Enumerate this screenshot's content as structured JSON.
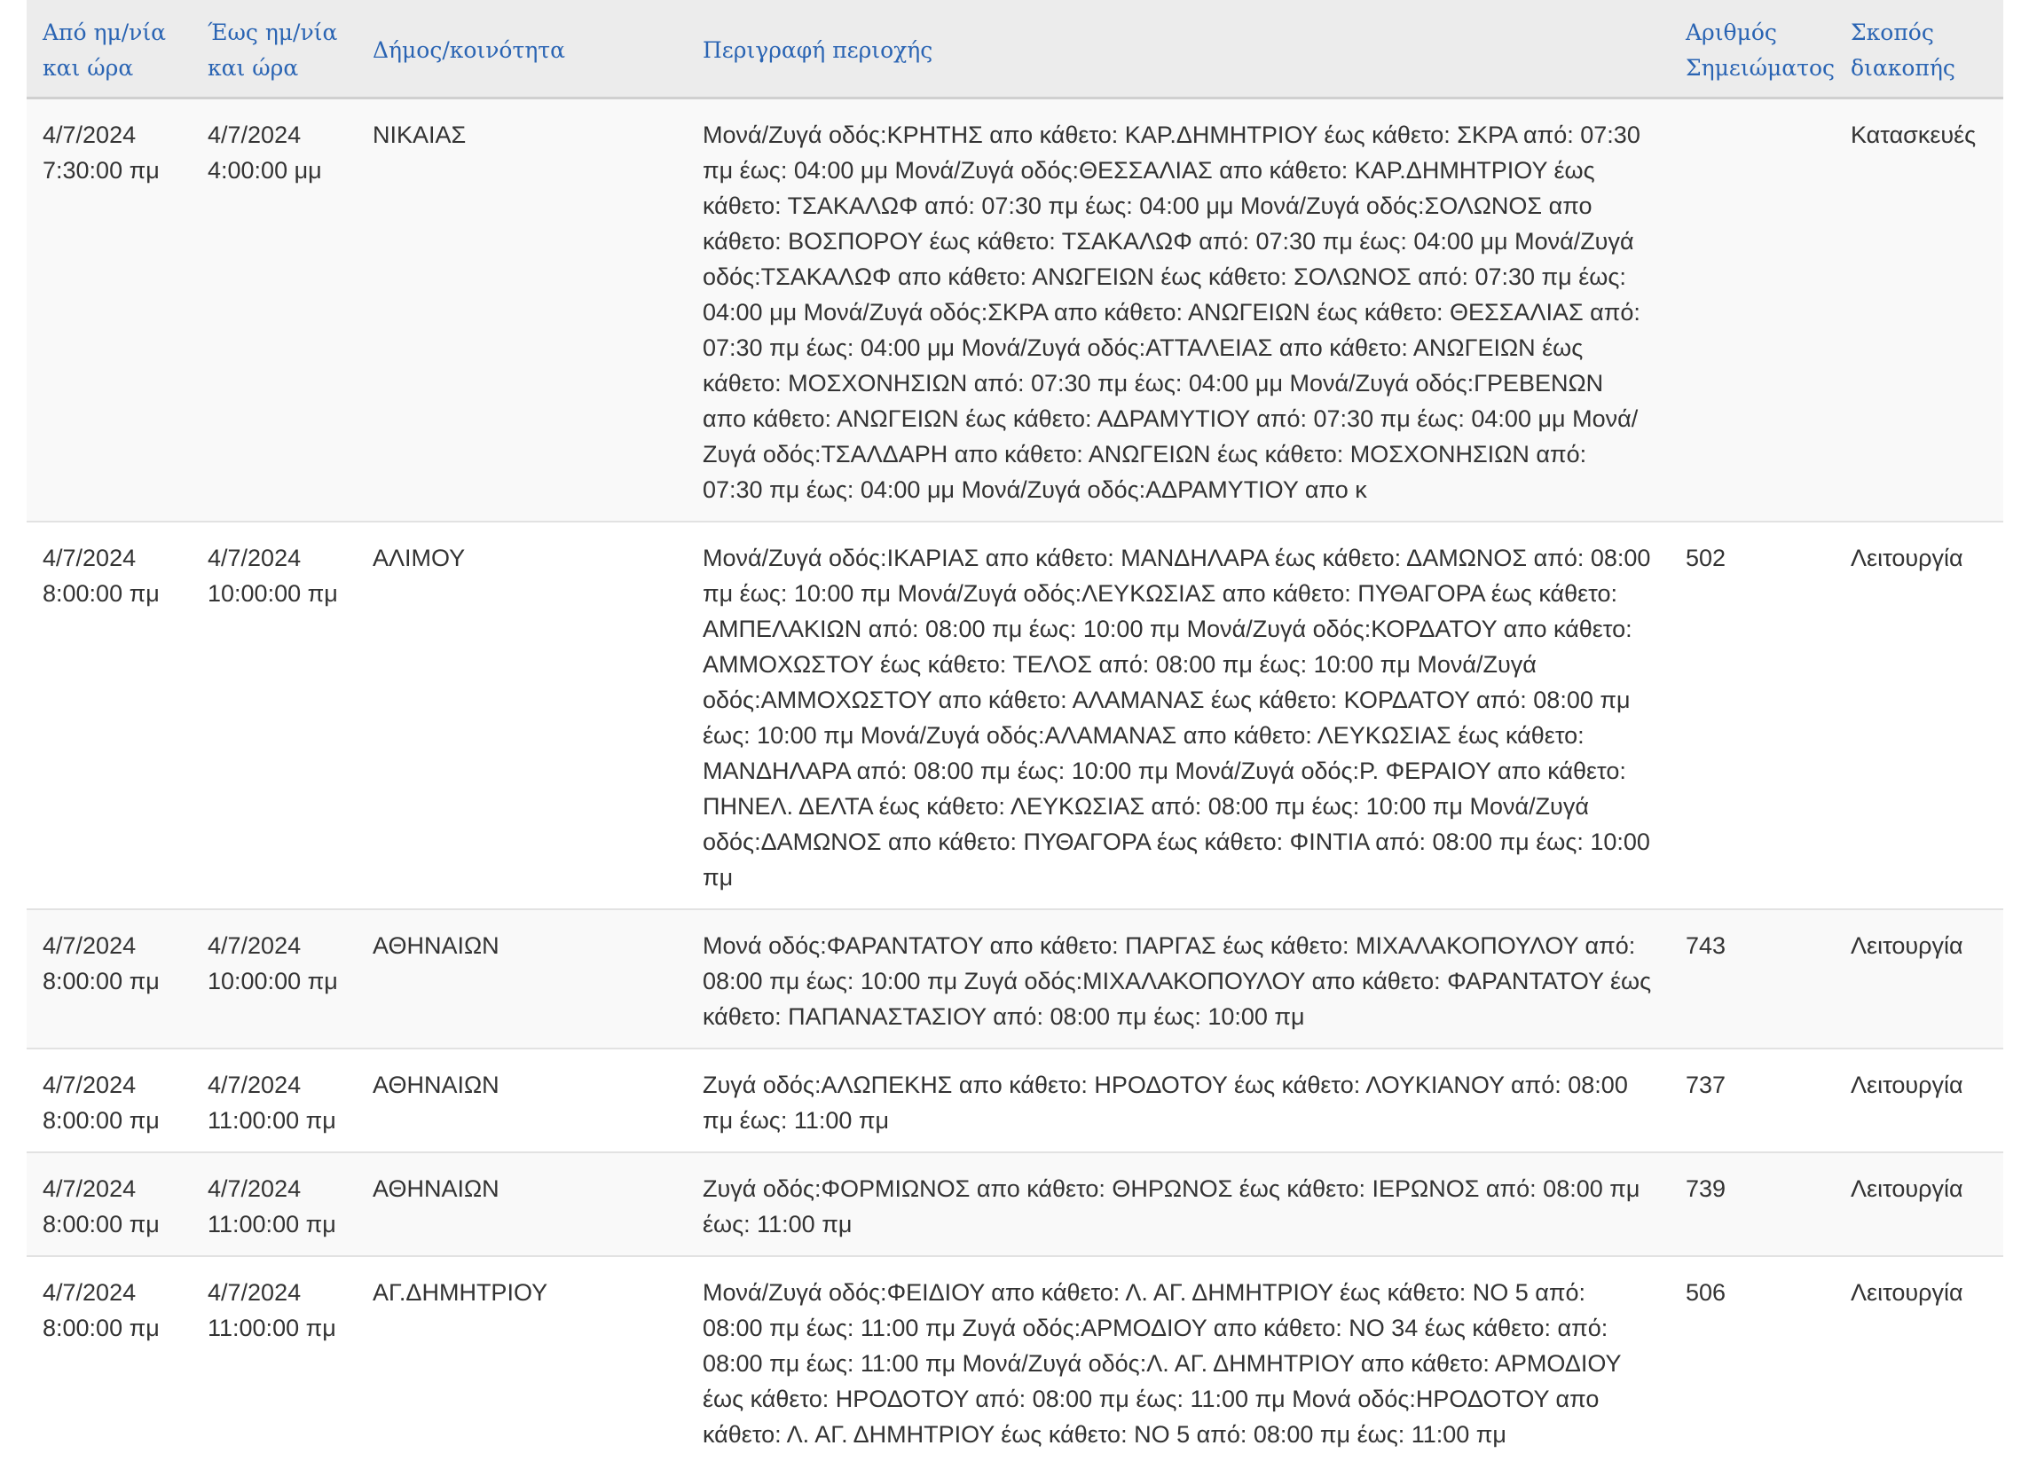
{
  "header": {
    "from": "Από ημ/νία και ώρα",
    "to": "Έως ημ/νία και ώρα",
    "municipality": "Δήμος/κοινότητα",
    "description": "Περιγραφή περιοχής",
    "note_number": "Αριθμός Σημειώματος",
    "purpose": "Σκοπός διακοπής"
  },
  "rows": [
    {
      "from": "4/7/2024 7:30:00 πμ",
      "to": "4/7/2024 4:00:00 μμ",
      "municipality": "ΝΙΚΑΙΑΣ",
      "description": "Μονά/Ζυγά οδός:ΚΡΗΤΗΣ απο κάθετο: ΚΑΡ.ΔΗΜΗΤΡΙΟΥ έως κάθετο: ΣΚΡΑ από: 07:30 πμ έως: 04:00 μμ Μονά/Ζυγά οδός:ΘΕΣΣΑΛΙΑΣ απο κάθετο: ΚΑΡ.ΔΗΜΗΤΡΙΟΥ έως κάθετο: ΤΣΑΚΑΛΩΦ από: 07:30 πμ έως: 04:00 μμ Μονά/Ζυγά οδός:ΣΟΛΩΝΟΣ απο κάθετο: ΒΟΣΠΟΡΟΥ έως κάθετο: ΤΣΑΚΑΛΩΦ από: 07:30 πμ έως: 04:00 μμ Μονά/Ζυγά οδός:ΤΣΑΚΑΛΩΦ απο κάθετο: ΑΝΩΓΕΙΩΝ έως κάθετο: ΣΟΛΩΝΟΣ από: 07:30 πμ έως: 04:00 μμ Μονά/Ζυγά οδός:ΣΚΡΑ απο κάθετο: ΑΝΩΓΕΙΩΝ έως κάθετο: ΘΕΣΣΑΛΙΑΣ από: 07:30 πμ έως: 04:00 μμ Μονά/Ζυγά οδός:ΑΤΤΑΛΕΙΑΣ απο κάθετο: ΑΝΩΓΕΙΩΝ έως κάθετο: ΜΟΣΧΟΝΗΣΙΩΝ από: 07:30 πμ έως: 04:00 μμ Μονά/Ζυγά οδός:ΓΡΕΒΕΝΩΝ απο κάθετο: ΑΝΩΓΕΙΩΝ έως κάθετο: ΑΔΡΑΜΥΤΙΟΥ από: 07:30 πμ έως: 04:00 μμ Μονά/Ζυγά οδός:ΤΣΑΛΔΑΡΗ απο κάθετο: ΑΝΩΓΕΙΩΝ έως κάθετο: ΜΟΣΧΟΝΗΣΙΩΝ από: 07:30 πμ έως: 04:00 μμ Μονά/Ζυγά οδός:ΑΔΡΑΜΥΤΙΟΥ απο κ",
      "note_number": "",
      "purpose": "Κατασκευές"
    },
    {
      "from": "4/7/2024 8:00:00 πμ",
      "to": "4/7/2024 10:00:00 πμ",
      "municipality": "ΑΛΙΜΟΥ",
      "description": "Μονά/Ζυγά οδός:ΙΚΑΡΙΑΣ απο κάθετο: ΜΑΝΔΗΛΑΡΑ έως κάθετο: ΔΑΜΩΝΟΣ από: 08:00 πμ έως: 10:00 πμ Μονά/Ζυγά οδός:ΛΕΥΚΩΣΙΑΣ απο κάθετο: ΠΥΘΑΓΟΡΑ έως κάθετο: ΑΜΠΕΛΑΚΙΩΝ από: 08:00 πμ έως: 10:00 πμ Μονά/Ζυγά οδός:ΚΟΡΔΑΤΟΥ απο κάθετο: ΑΜΜΟΧΩΣΤΟΥ έως κάθετο: ΤΕΛΟΣ από: 08:00 πμ έως: 10:00 πμ Μονά/Ζυγά οδός:ΑΜΜΟΧΩΣΤΟΥ απο κάθετο: ΑΛΑΜΑΝΑΣ έως κάθετο: ΚΟΡΔΑΤΟΥ από: 08:00 πμ έως: 10:00 πμ Μονά/Ζυγά οδός:ΑΛΑΜΑΝΑΣ απο κάθετο: ΛΕΥΚΩΣΙΑΣ έως κάθετο: ΜΑΝΔΗΛΑΡΑ από: 08:00 πμ έως: 10:00 πμ Μονά/Ζυγά οδός:Ρ. ΦΕΡΑΙΟΥ απο κάθετο: ΠΗΝΕΛ. ΔΕΛΤΑ έως κάθετο: ΛΕΥΚΩΣΙΑΣ από: 08:00 πμ έως: 10:00 πμ Μονά/Ζυγά οδός:ΔΑΜΩΝΟΣ απο κάθετο: ΠΥΘΑΓΟΡΑ έως κάθετο: ΦΙΝΤΙΑ από: 08:00 πμ έως: 10:00 πμ",
      "note_number": "502",
      "purpose": "Λειτουργία"
    },
    {
      "from": "4/7/2024 8:00:00 πμ",
      "to": "4/7/2024 10:00:00 πμ",
      "municipality": "ΑΘΗΝΑΙΩΝ",
      "description": "Μονά οδός:ΦΑΡΑΝΤΑΤΟΥ απο κάθετο: ΠΑΡΓΑΣ έως κάθετο: ΜΙΧΑΛΑΚΟΠΟΥΛΟΥ από: 08:00 πμ έως: 10:00 πμ Ζυγά οδός:ΜΙΧΑΛΑΚΟΠΟΥΛΟΥ απο κάθετο: ΦΑΡΑΝΤΑΤΟΥ έως κάθετο: ΠΑΠΑΝΑΣΤΑΣΙΟΥ από: 08:00 πμ έως: 10:00 πμ",
      "note_number": "743",
      "purpose": "Λειτουργία"
    },
    {
      "from": "4/7/2024 8:00:00 πμ",
      "to": "4/7/2024 11:00:00 πμ",
      "municipality": "ΑΘΗΝΑΙΩΝ",
      "description": "Ζυγά οδός:ΑΛΩΠΕΚΗΣ απο κάθετο: ΗΡΟΔΟΤΟΥ έως κάθετο: ΛΟΥΚΙΑΝΟΥ από: 08:00 πμ έως: 11:00 πμ",
      "note_number": "737",
      "purpose": "Λειτουργία"
    },
    {
      "from": "4/7/2024 8:00:00 πμ",
      "to": "4/7/2024 11:00:00 πμ",
      "municipality": "ΑΘΗΝΑΙΩΝ",
      "description": "Ζυγά οδός:ΦΟΡΜΙΩΝΟΣ απο κάθετο: ΘΗΡΩΝΟΣ έως κάθετο: ΙΕΡΩΝΟΣ από: 08:00 πμ έως: 11:00 πμ",
      "note_number": "739",
      "purpose": "Λειτουργία"
    },
    {
      "from": "4/7/2024 8:00:00 πμ",
      "to": "4/7/2024 11:00:00 πμ",
      "municipality": "ΑΓ.ΔΗΜΗΤΡΙΟΥ",
      "description": "Μονά/Ζυγά οδός:ΦΕΙΔΙΟΥ απο κάθετο: Λ. ΑΓ. ΔΗΜΗΤΡΙΟΥ έως κάθετο: ΝΟ 5 από: 08:00 πμ έως: 11:00 πμ Ζυγά οδός:ΑΡΜΟΔΙΟΥ απο κάθετο: ΝΟ 34 έως κάθετο: από: 08:00 πμ έως: 11:00 πμ Μονά/Ζυγά οδός:Λ. ΑΓ. ΔΗΜΗΤΡΙΟΥ απο κάθετο: ΑΡΜΟΔΙΟΥ έως κάθετο: ΗΡΟΔΟΤΟΥ από: 08:00 πμ έως: 11:00 πμ Μονά οδός:ΗΡΟΔΟΤΟΥ απο κάθετο: Λ. ΑΓ. ΔΗΜΗΤΡΙΟΥ έως κάθετο: ΝΟ 5 από: 08:00 πμ έως: 11:00 πμ",
      "note_number": "506",
      "purpose": "Λειτουργία"
    }
  ]
}
